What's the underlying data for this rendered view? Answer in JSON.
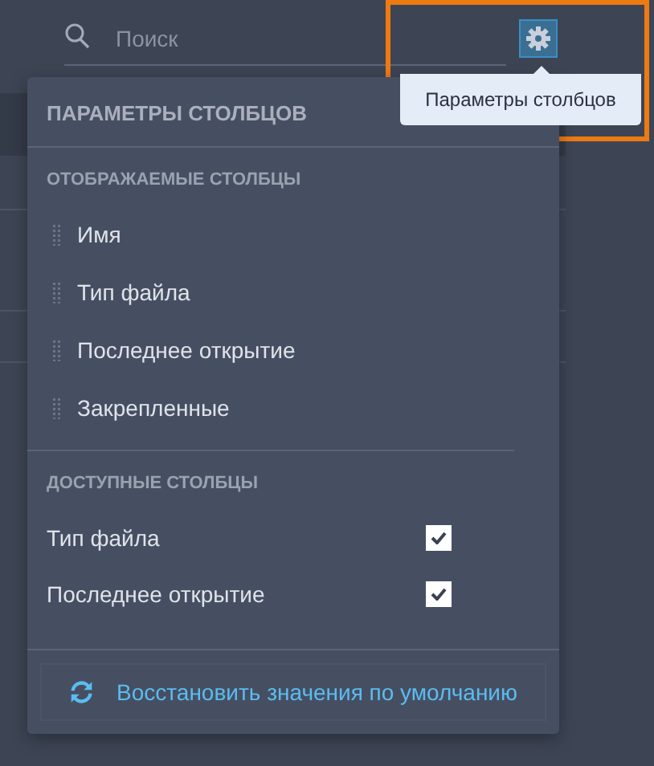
{
  "search": {
    "placeholder": "Поиск"
  },
  "settings_button": {
    "tooltip": "Параметры столбцов",
    "highlighted": true
  },
  "column_menu": {
    "title": "ПАРАМЕТРЫ СТОЛБЦОВ",
    "sections": [
      {
        "kind": "draggable",
        "heading": "ОТОБРАЖАЕМЫЕ СТОЛБЦЫ",
        "items": [
          {
            "label": "Имя"
          },
          {
            "label": "Тип файла"
          },
          {
            "label": "Последнее открытие"
          },
          {
            "label": "Закрепленные"
          }
        ]
      },
      {
        "kind": "checkbox",
        "heading": "ДОСТУПНЫЕ СТОЛБЦЫ",
        "items": [
          {
            "label": "Тип файла",
            "checked": true
          },
          {
            "label": "Последнее открытие",
            "checked": true
          }
        ]
      }
    ],
    "reset_link": "Восстановить значения по умолчанию"
  }
}
